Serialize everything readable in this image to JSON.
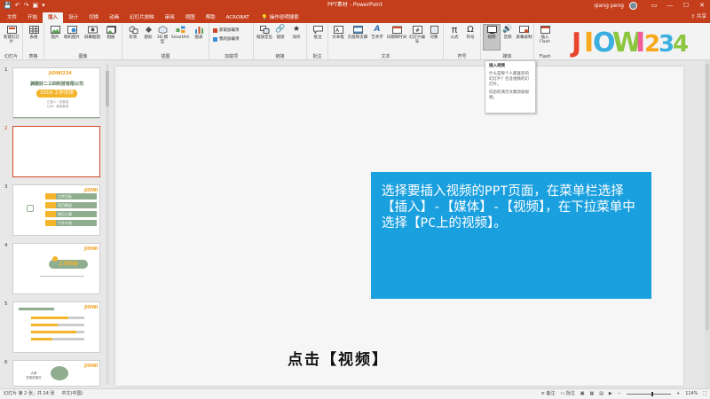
{
  "titlebar": {
    "qat": [
      "💾",
      "↶",
      "↷",
      "▣",
      "▾"
    ],
    "title": "PPT素材 - PowerPoint",
    "user": "qiang peng",
    "window_buttons": [
      "▭",
      "—",
      "☐",
      "✕"
    ],
    "bg": "#c43e1c"
  },
  "tabs": [
    "文件",
    "开始",
    "插入",
    "设计",
    "切换",
    "动画",
    "幻灯片放映",
    "审阅",
    "视图",
    "帮助",
    "ACROBAT"
  ],
  "active_tab_index": 2,
  "tell_me": "操作说明搜索",
  "share": "共享",
  "ribbon": {
    "groups": [
      {
        "label": "幻灯片",
        "buttons": [
          {
            "label": "新建幻灯片",
            "icon": "new-slide-icon"
          }
        ]
      },
      {
        "label": "表格",
        "buttons": [
          {
            "label": "表格",
            "icon": "table-icon"
          }
        ]
      },
      {
        "label": "图像",
        "buttons": [
          {
            "label": "图片",
            "icon": "picture-icon"
          },
          {
            "label": "联机图片",
            "icon": "online-picture-icon"
          },
          {
            "label": "屏幕截图",
            "icon": "screenshot-icon"
          },
          {
            "label": "相册",
            "icon": "album-icon"
          }
        ]
      },
      {
        "label": "插图",
        "buttons": [
          {
            "label": "形状",
            "icon": "shapes-icon"
          },
          {
            "label": "图标",
            "icon": "icons-icon"
          },
          {
            "label": "3D 模型",
            "icon": "3d-model-icon"
          },
          {
            "label": "SmartArt",
            "icon": "smartart-icon"
          },
          {
            "label": "图表",
            "icon": "chart-icon"
          }
        ]
      },
      {
        "label": "加载项",
        "small": [
          "获取加载项",
          "我的加载项"
        ]
      },
      {
        "label": "链接",
        "buttons": [
          {
            "label": "缩放定位",
            "icon": "zoom-icon"
          },
          {
            "label": "链接",
            "icon": "link-icon"
          },
          {
            "label": "动作",
            "icon": "action-icon"
          }
        ]
      },
      {
        "label": "批注",
        "buttons": [
          {
            "label": "批注",
            "icon": "comment-icon"
          }
        ]
      },
      {
        "label": "文本",
        "buttons": [
          {
            "label": "文本框",
            "icon": "textbox-icon"
          },
          {
            "label": "页眉和页脚",
            "icon": "header-footer-icon"
          },
          {
            "label": "艺术字",
            "icon": "wordart-icon"
          },
          {
            "label": "日期和时间",
            "icon": "datetime-icon"
          },
          {
            "label": "幻灯片编号",
            "icon": "slide-number-icon"
          },
          {
            "label": "对象",
            "icon": "object-icon"
          }
        ]
      },
      {
        "label": "符号",
        "buttons": [
          {
            "label": "公式",
            "icon": "equation-icon"
          },
          {
            "label": "符号",
            "icon": "symbol-icon"
          }
        ]
      },
      {
        "label": "媒体",
        "buttons": [
          {
            "label": "视频",
            "icon": "video-icon"
          },
          {
            "label": "音频",
            "icon": "audio-icon"
          },
          {
            "label": "屏幕录制",
            "icon": "screen-record-icon"
          }
        ]
      },
      {
        "label": "Flash",
        "buttons": [
          {
            "label": "插入 Flash",
            "icon": "flash-icon"
          }
        ]
      }
    ]
  },
  "logo": {
    "text": "JIOWI234",
    "colors": [
      "#e8452c",
      "#f7a81b",
      "#3bb0e0",
      "#8dc63f",
      "#f25c9a"
    ]
  },
  "tooltip": {
    "title": "插入视频",
    "line1": "什么是每个人都喜欢的幻灯片？包含视频的幻灯片。",
    "line2": "向您的演示文稿添加视频。"
  },
  "thumbnails": [
    {
      "num": "1",
      "company": "渊做好二三四科技有限公司",
      "plan": "2019 工作安排",
      "sub": "汇报人：张某某\n公司：某某某某"
    },
    {
      "num": "2"
    },
    {
      "num": "3",
      "items": [
        "工作目标",
        "项目概述",
        "常见之事",
        "下步计划"
      ]
    },
    {
      "num": "4",
      "title": "工作目标"
    },
    {
      "num": "5"
    },
    {
      "num": "6",
      "caption": "大家\n完成的部分"
    }
  ],
  "slide": {
    "box_text": "选择要插入视频的PPT页面，在菜单栏选择【插入】-【媒体】-【视频】，在下拉菜单中选择【PC上的视频】。",
    "box_color": "#1a9fdf"
  },
  "subtitle": "点击【视频】",
  "status": {
    "slide_info": "幻灯片 第 2 张，共 24 张",
    "language": "中文(中国)",
    "notes": "备注",
    "comments": "批注",
    "zoom": "114%"
  }
}
